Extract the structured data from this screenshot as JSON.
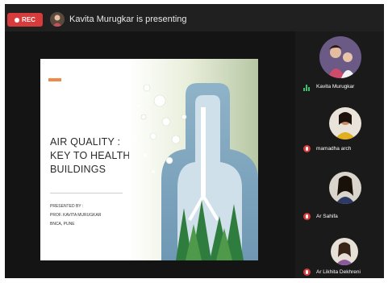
{
  "recording": {
    "label": "REC"
  },
  "presenter": {
    "status_text": "Kavita Murugkar is presenting"
  },
  "slide": {
    "title_lines": [
      "AIR QUALITY :",
      "KEY TO HEALTHY",
      "BUILDINGS"
    ],
    "presented_by_lines": [
      "PRESENTED BY :",
      "PROF. KAVITA MURUGKAR",
      "BNCA, PUNE"
    ],
    "footer": "",
    "accent_color": "#f0884a"
  },
  "participants": [
    {
      "name": "Kavita Murugkar",
      "mic": "on",
      "avatar": "woman-with-child-photo"
    },
    {
      "name": "mamadha arch",
      "mic": "muted",
      "avatar": "woman-portrait-photo"
    },
    {
      "name": "Ar Sahifa",
      "mic": "muted",
      "avatar": "woman-portrait-photo"
    },
    {
      "name": "Ar Likhita Dekhreni",
      "mic": "muted",
      "avatar": "woman-portrait-photo"
    }
  ],
  "colors": {
    "record": "#d83b3b",
    "mic_active": "#3bc16d"
  }
}
